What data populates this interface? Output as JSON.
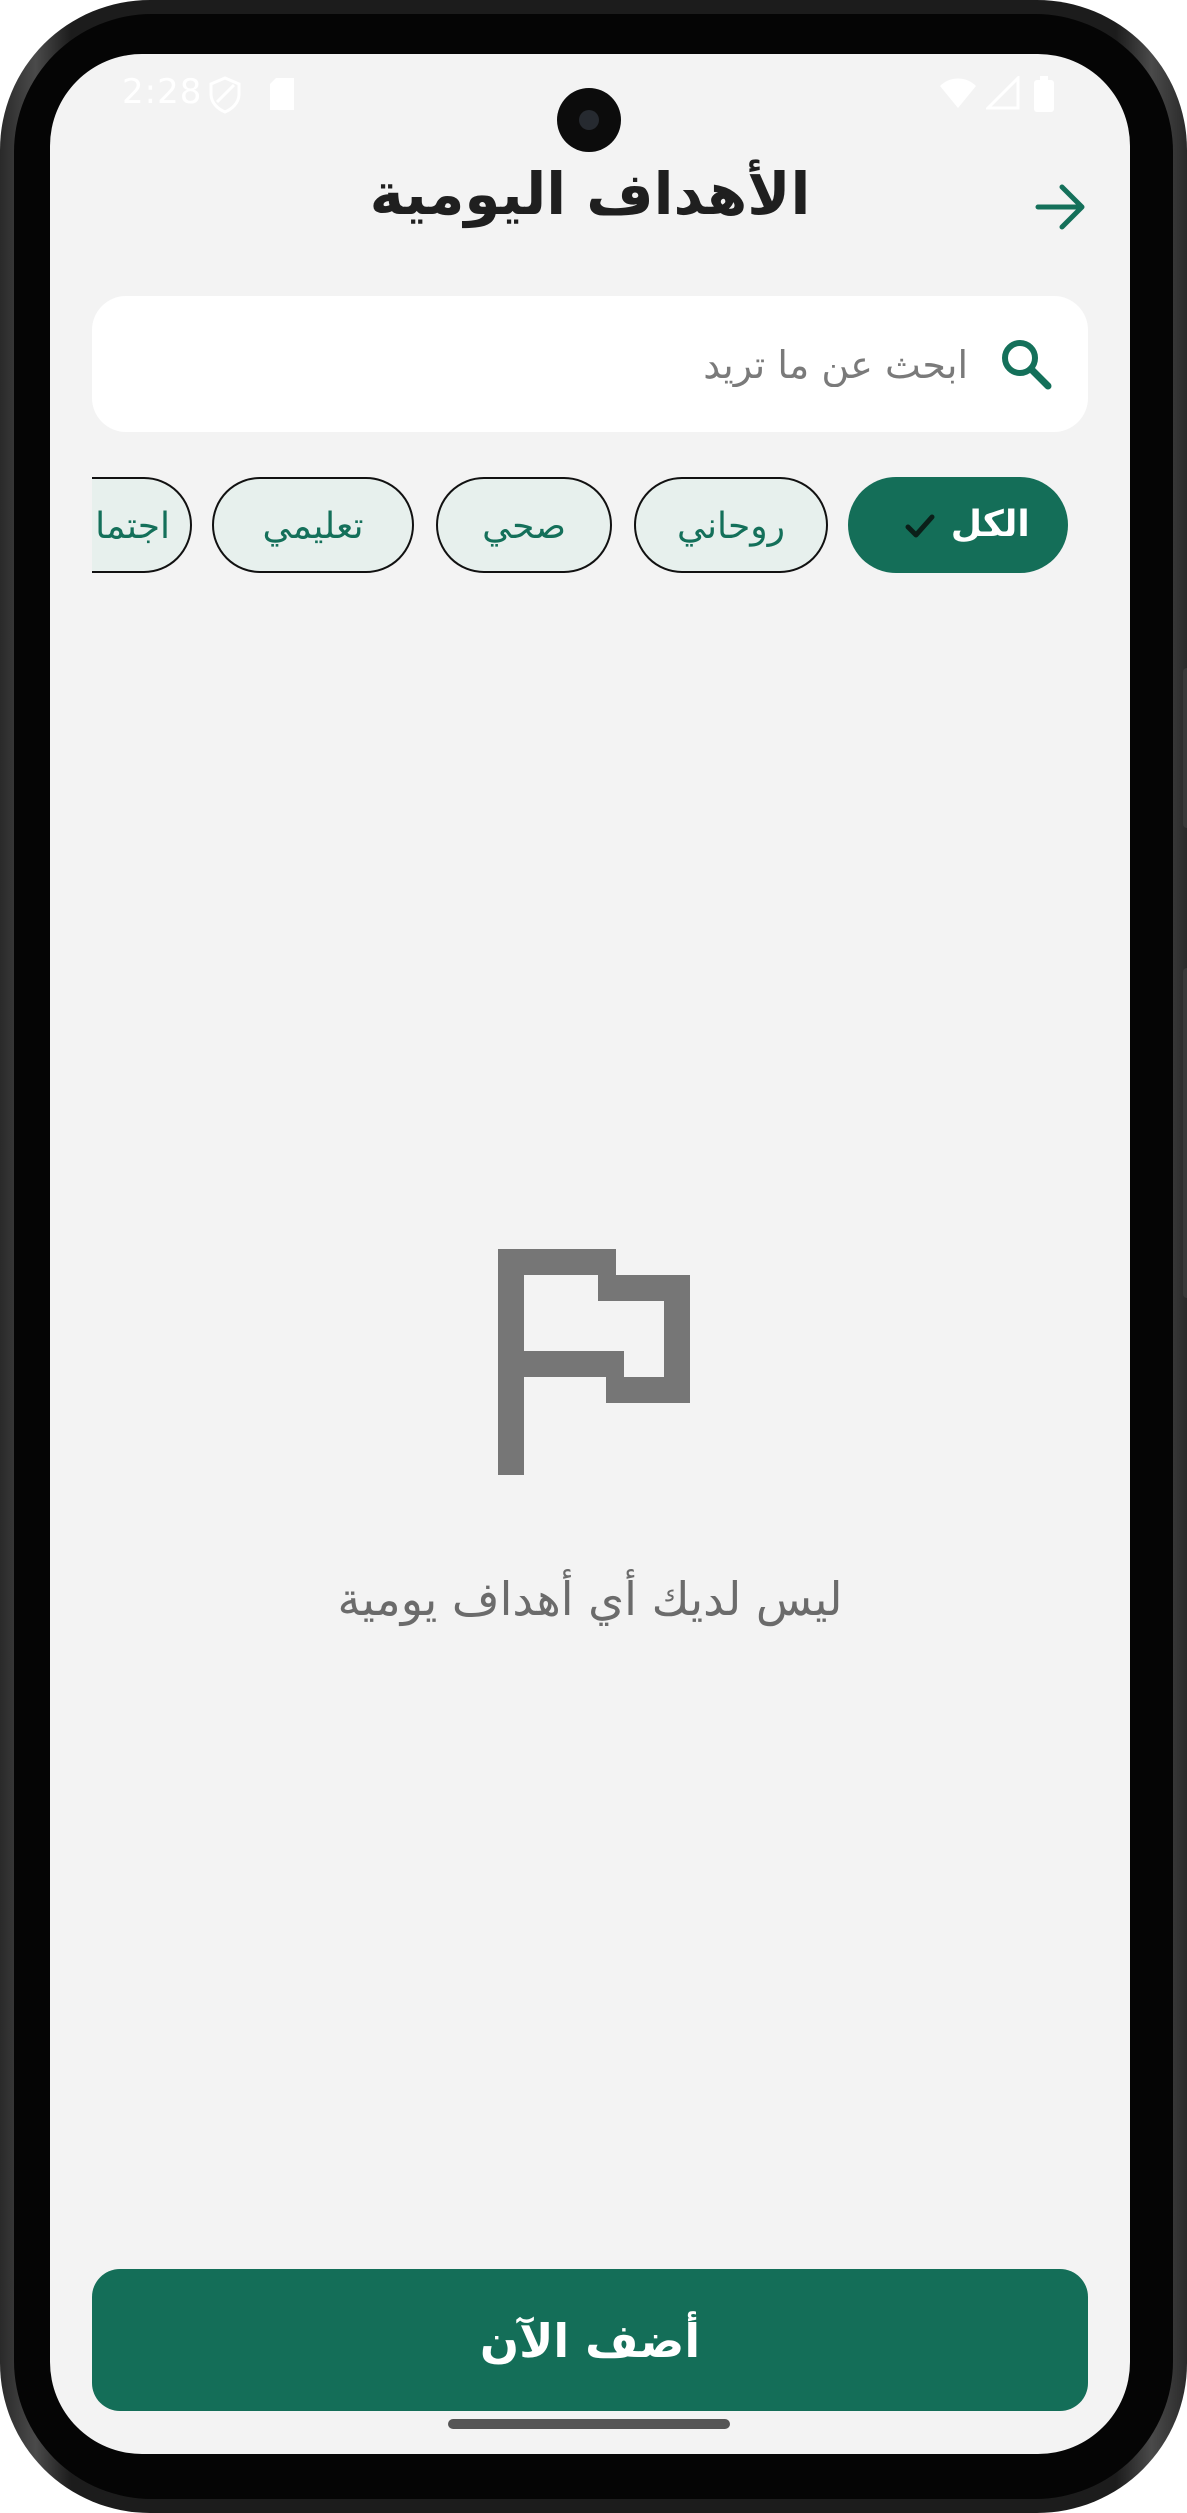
{
  "status_bar": {
    "time": "2:28",
    "icons": [
      "shield-icon",
      "sd-card-icon",
      "wifi-icon",
      "signal-icon",
      "battery-icon"
    ]
  },
  "header": {
    "title": "الأهداف اليومية",
    "back_icon": "arrow-right-icon"
  },
  "search": {
    "placeholder": "ابحث عن ما تريد",
    "value": "",
    "icon": "search-icon"
  },
  "filters": [
    {
      "label": "الكل",
      "selected": true
    },
    {
      "label": "روحاني",
      "selected": false
    },
    {
      "label": "صحي",
      "selected": false
    },
    {
      "label": "تعليمي",
      "selected": false
    },
    {
      "label": "اجتماعي",
      "selected": false
    }
  ],
  "empty_state": {
    "icon": "flag-icon",
    "message": "ليس لديك أي أهداف يومية"
  },
  "add_button": {
    "label": "أضف الآن"
  },
  "colors": {
    "primary": "#146e58",
    "background": "#f3f3f3",
    "chip_background": "#e7f0ed",
    "muted_text": "#6b6b6b"
  }
}
